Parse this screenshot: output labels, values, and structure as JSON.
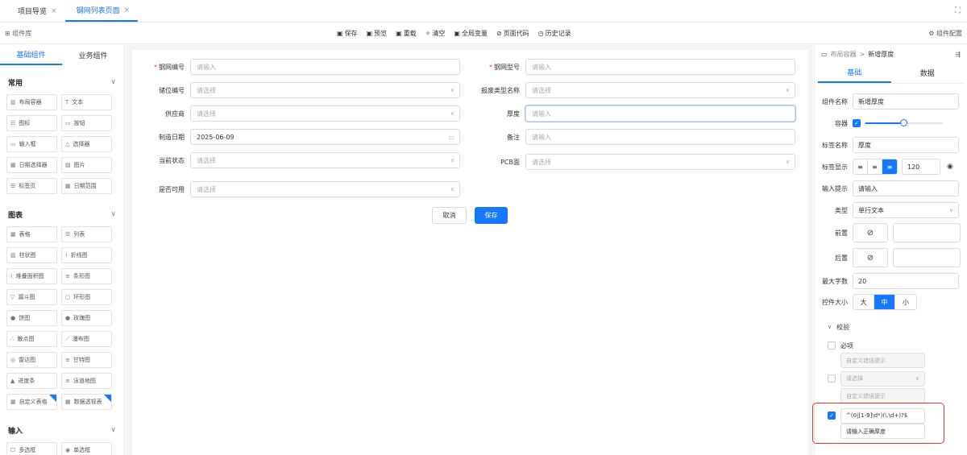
{
  "tabs": [
    {
      "label": "项目导览",
      "close": "×"
    },
    {
      "label": "钢网列表页面",
      "close": "×"
    }
  ],
  "fullscreen_icon": "⛶",
  "toolbar": {
    "library_label": "组件库",
    "save": "保存",
    "preview": "预览",
    "reload": "重载",
    "clear": "清空",
    "global_vars": "全局变量",
    "page_code": "页面代码",
    "history": "历史记录",
    "config": "组件配置"
  },
  "left_panel": {
    "tabs": [
      "基础组件",
      "业务组件"
    ],
    "categories": [
      {
        "name": "常用",
        "items": [
          {
            "icon": "▥",
            "label": "布局容器"
          },
          {
            "icon": "T",
            "label": "文本"
          },
          {
            "icon": "☷",
            "label": "图标"
          },
          {
            "icon": "▭",
            "label": "按钮"
          },
          {
            "icon": "▭",
            "label": "输入框"
          },
          {
            "icon": "△",
            "label": "选择器"
          },
          {
            "icon": "▦",
            "label": "日期选择器"
          },
          {
            "icon": "▨",
            "label": "图片"
          },
          {
            "icon": "☰",
            "label": "标签页"
          },
          {
            "icon": "▦",
            "label": "日期范围"
          }
        ]
      },
      {
        "name": "图表",
        "items": [
          {
            "icon": "▦",
            "label": "表格"
          },
          {
            "icon": "☰",
            "label": "列表"
          },
          {
            "icon": "▥",
            "label": "柱状图"
          },
          {
            "icon": "≀",
            "label": "折线图"
          },
          {
            "icon": "≀",
            "label": "堆叠面积图"
          },
          {
            "icon": "≡",
            "label": "条形图"
          },
          {
            "icon": "▽",
            "label": "漏斗图"
          },
          {
            "icon": "○",
            "label": "环形图"
          },
          {
            "icon": "●",
            "label": "饼图"
          },
          {
            "icon": "●",
            "label": "玫瑰图"
          },
          {
            "icon": "∴",
            "label": "散点图"
          },
          {
            "icon": "⟋",
            "label": "瀑布图"
          },
          {
            "icon": "◎",
            "label": "雷达图"
          },
          {
            "icon": "≡",
            "label": "甘特图"
          },
          {
            "icon": "▲",
            "label": "进度条"
          },
          {
            "icon": "≡",
            "label": "泳道地图"
          },
          {
            "icon": "▦",
            "label": "自定义表格"
          },
          {
            "icon": "▦",
            "label": "数据透视表"
          }
        ]
      },
      {
        "name": "输入",
        "items": [
          {
            "icon": "☐",
            "label": "多选框"
          },
          {
            "icon": "◉",
            "label": "单选框"
          }
        ]
      }
    ]
  },
  "form": {
    "fields": [
      {
        "label": "钢网编号",
        "required": true,
        "value": "请输入",
        "placeholder": true,
        "kind": "input"
      },
      {
        "label": "钢网型号",
        "required": true,
        "value": "请输入",
        "placeholder": true,
        "kind": "input"
      },
      {
        "label": "储位编号",
        "required": false,
        "value": "请选择",
        "placeholder": true,
        "kind": "select"
      },
      {
        "label": "报废类型名称",
        "required": false,
        "value": "请选择",
        "placeholder": true,
        "kind": "select"
      },
      {
        "label": "供应商",
        "required": false,
        "value": "请选择",
        "placeholder": true,
        "kind": "select"
      },
      {
        "label": "厚度",
        "required": false,
        "value": "请输入",
        "placeholder": true,
        "kind": "input"
      },
      {
        "label": "制造日期",
        "required": false,
        "value": "2025-06-09",
        "placeholder": false,
        "kind": "date"
      },
      {
        "label": "备注",
        "required": false,
        "value": "请输入",
        "placeholder": true,
        "kind": "input"
      },
      {
        "label": "当前状态",
        "required": false,
        "value": "请选择",
        "placeholder": true,
        "kind": "select"
      },
      {
        "label": "PCB面",
        "required": false,
        "value": "请选择",
        "placeholder": true,
        "kind": "select"
      },
      {
        "label": "是否可用",
        "required": false,
        "value": "请选择",
        "placeholder": true,
        "kind": "select"
      }
    ],
    "cancel": "取消",
    "save": "保存"
  },
  "right_panel": {
    "crumb_root": "布局容器",
    "crumb_sep": ">",
    "crumb_current": "新增厚度",
    "tabs": [
      "基础",
      "数据"
    ],
    "component_name_label": "组件名称",
    "component_name": "新增厚度",
    "container_label": "容器",
    "container_slider": 0.5,
    "tag_name_label": "标签名称",
    "tag_name": "厚度",
    "tag_display_label": "标签显示",
    "tag_width": "120",
    "placeholder_label": "输入提示",
    "placeholder_value": "请输入",
    "type_label": "类型",
    "type_value": "单行文本",
    "prefix_label": "前置",
    "suffix_label": "后置",
    "maxlen_label": "最大字数",
    "maxlen_value": "20",
    "size_label": "控件大小",
    "sizes": [
      "大",
      "中",
      "小"
    ],
    "validation_label": "校验",
    "required_label": "必项",
    "custom_error": "自定义错误提示",
    "select_placeholder": "请选择",
    "regex": "^(0|[1-9]\\d*)(\\.\\d+)?$",
    "regex_error": "请输入正确厚度"
  },
  "colors": {
    "accent": "#1677ff",
    "highlight": "#e5342a"
  }
}
